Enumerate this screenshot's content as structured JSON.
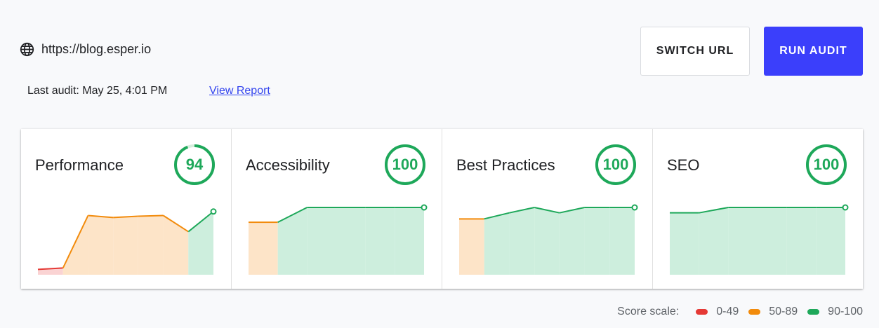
{
  "header": {
    "globe_icon": "globe-icon",
    "url": "https://blog.esper.io",
    "last_audit": "Last audit: May 25, 4:01 PM",
    "view_report": "View Report",
    "switch_url": "SWITCH URL",
    "run_audit": "RUN AUDIT"
  },
  "colors": {
    "accent": "#3b3ffb",
    "good": "#1ea85a",
    "average": "#f28b0c",
    "poor": "#e53935"
  },
  "cards": [
    {
      "title": "Performance",
      "score": "94"
    },
    {
      "title": "Accessibility",
      "score": "100"
    },
    {
      "title": "Best Practices",
      "score": "100"
    },
    {
      "title": "SEO",
      "score": "100"
    }
  ],
  "legend": {
    "label": "Score scale:",
    "items": [
      {
        "label": "0-49",
        "color": "#e53935"
      },
      {
        "label": "50-89",
        "color": "#f28b0c"
      },
      {
        "label": "90-100",
        "color": "#1ea85a"
      }
    ]
  },
  "chart_data": [
    {
      "type": "area",
      "title": "Performance",
      "x": [
        1,
        2,
        3,
        4,
        5,
        6,
        7,
        8
      ],
      "values": [
        8,
        10,
        88,
        85,
        87,
        88,
        64,
        94
      ]
    },
    {
      "type": "area",
      "title": "Accessibility",
      "x": [
        1,
        2,
        3,
        4,
        5,
        6,
        7
      ],
      "values": [
        78,
        78,
        100,
        100,
        100,
        100,
        100
      ]
    },
    {
      "type": "area",
      "title": "Best Practices",
      "x": [
        1,
        2,
        3,
        4,
        5,
        6,
        7,
        8
      ],
      "values": [
        83,
        83,
        92,
        100,
        92,
        100,
        100,
        100
      ]
    },
    {
      "type": "area",
      "title": "SEO",
      "x": [
        1,
        2,
        3,
        4,
        5,
        6,
        7
      ],
      "values": [
        92,
        92,
        100,
        100,
        100,
        100,
        100
      ]
    }
  ]
}
